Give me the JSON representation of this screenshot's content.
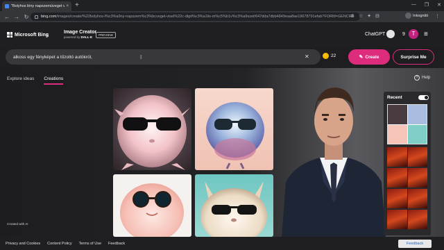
{
  "browser": {
    "tab_title": "\"Bolyhos lény napszemüveget vis",
    "tab_close": "×",
    "new_tab": "+",
    "window_controls": [
      "—",
      "❐",
      "✕"
    ],
    "url_host": "bing.com",
    "url_path": "/images/create/%22bolyhos-l%c3%a9ny-napszem%c3%bcveget-visel%22c-digit%c3%a1lis-m%c5%b1v%c3%a9szet/647dda7dbb4849eaa8ae19678791efab?FORM=GENCRE",
    "profile": "Inkognitó",
    "back": "←",
    "forward": "→",
    "reload": "↻",
    "menu": "⋮",
    "ext_icons": [
      "⊘",
      "☆",
      "✦",
      "⊟"
    ]
  },
  "header": {
    "logo_text": "Microsoft Bing",
    "product": "Image Creator",
    "powered_by": "powered by",
    "powered_by_brand": "DALL·E",
    "preview_badge": "PREVIEW",
    "chatgpt": "ChatGPT",
    "coins": "9",
    "trophy_letter": "T",
    "search_icon": "⌕",
    "menu_icon": "≡"
  },
  "prompt": {
    "text": "alkoss egy fényképet a tűzoltó autókról,",
    "clear": "✕",
    "cursor": "I",
    "boosts": "22",
    "coin_icon": "⬤",
    "create_label": "Create",
    "create_icon": "✎",
    "surprise_label": "Surprise Me"
  },
  "tabs": {
    "explore": "Explore ideas",
    "creations": "Creations",
    "help": "Help",
    "help_icon": "?"
  },
  "recent": {
    "title": "Recent"
  },
  "created_with_ai": "Created with AI",
  "footer": {
    "links": [
      "Privacy and Cookies",
      "Content Policy",
      "Terms of Use",
      "Feedback"
    ],
    "feedback_button": "Feedback"
  }
}
